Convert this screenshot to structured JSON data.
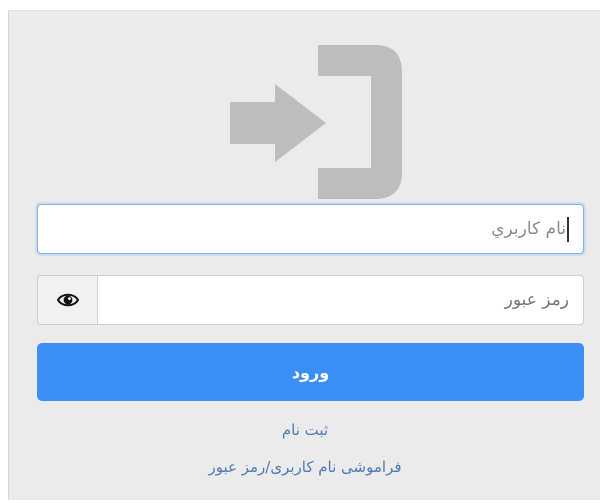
{
  "form": {
    "username": {
      "value": "نام کاربري"
    },
    "password": {
      "placeholder": "رمز عبور"
    },
    "login_label": "ورود",
    "register_label": "ثبت نام",
    "forgot_label": "فراموشی نام کاربری/رمز عبور"
  },
  "icons": {
    "login": "login-icon",
    "password_toggle": "eye-icon"
  },
  "colors": {
    "panel_background": "#ebebeb",
    "primary": "#3b8ef3",
    "link": "#4e79b3",
    "icon_gray": "#bdbdbd"
  }
}
